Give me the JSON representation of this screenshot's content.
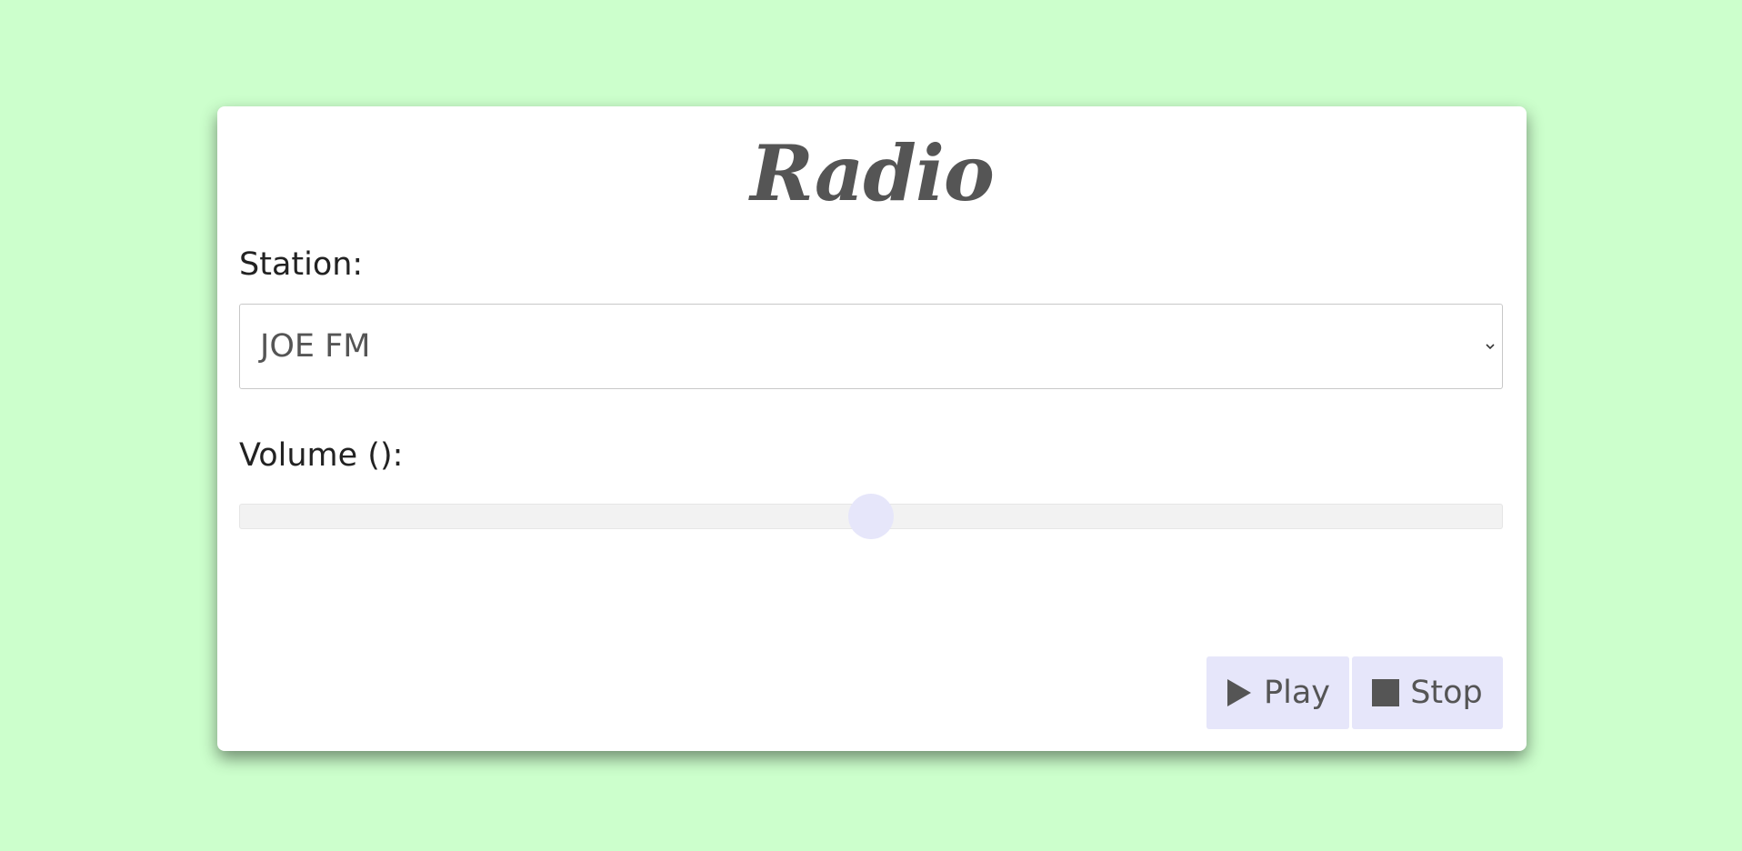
{
  "app": {
    "title": "Radio"
  },
  "station": {
    "label": "Station:",
    "selected": "JOE FM"
  },
  "volume": {
    "label": "Volume ():",
    "level_fraction": 0.5
  },
  "controls": {
    "play_label": "Play",
    "stop_label": "Stop"
  },
  "icons": {
    "play": "play-icon",
    "stop": "stop-icon",
    "dropdown": "chevron-down-icon"
  },
  "colors": {
    "background": "#ccffcc",
    "card": "#ffffff",
    "accent": "#e6e6fa",
    "title": "#555555"
  }
}
